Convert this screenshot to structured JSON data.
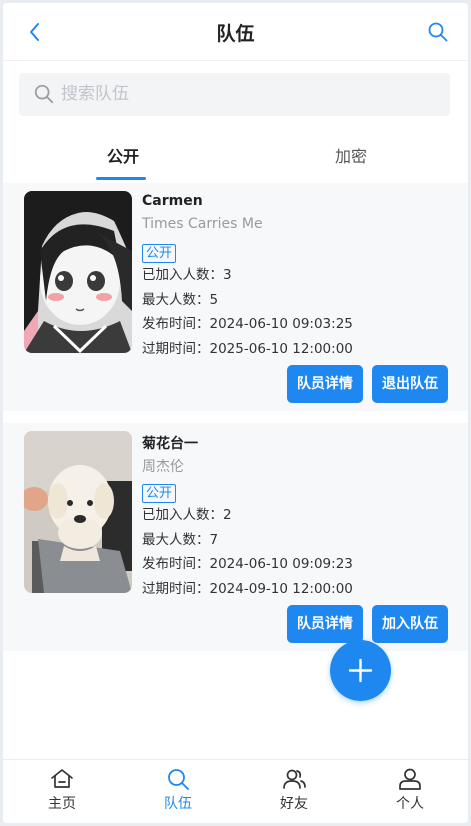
{
  "header": {
    "title": "队伍"
  },
  "search": {
    "placeholder": "搜索队伍",
    "value": ""
  },
  "tabs": [
    {
      "label": "公开"
    },
    {
      "label": "加密"
    }
  ],
  "teams": [
    {
      "name": "Carmen",
      "slogan": "Times Carries Me",
      "badge": "公开",
      "rows": [
        "已加入人数：3",
        "最大人数：5",
        "发布时间：2024-06-10 09:03:25",
        "过期时间：2025-06-10 12:00:00"
      ],
      "btn_detail": "队员详情",
      "btn_action": "退出队伍"
    },
    {
      "name": "菊花台一",
      "slogan": "周杰伦",
      "badge": "公开",
      "rows": [
        "已加入人数：2",
        "最大人数：7",
        "发布时间：2024-06-10 09:09:23",
        "过期时间：2024-09-10 12:00:00"
      ],
      "btn_detail": "队员详情",
      "btn_action": "加入队伍"
    }
  ],
  "nav": [
    {
      "label": "主页",
      "icon": "home-icon"
    },
    {
      "label": "队伍",
      "icon": "search-icon"
    },
    {
      "label": "好友",
      "icon": "friends-icon"
    },
    {
      "label": "个人",
      "icon": "user-icon"
    }
  ],
  "colors": {
    "accent": "#1e88f0",
    "card_bg": "#f7f8fa"
  }
}
